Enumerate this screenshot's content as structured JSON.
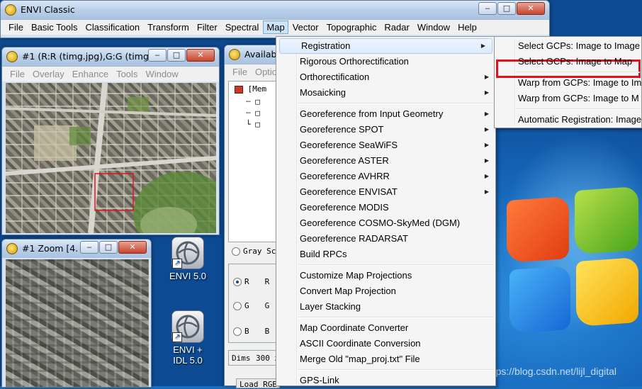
{
  "envi_main": {
    "title": "ENVI Classic",
    "menus": [
      "File",
      "Basic Tools",
      "Classification",
      "Transform",
      "Filter",
      "Spectral",
      "Map",
      "Vector",
      "Topographic",
      "Radar",
      "Window",
      "Help"
    ],
    "active_menu": "Map"
  },
  "image_window": {
    "title": "#1 (R:R (timg.jpg),G:G (timg.j...",
    "menus": [
      "File",
      "Overlay",
      "Enhance",
      "Tools",
      "Window"
    ]
  },
  "zoom_window": {
    "title": "#1 Zoom [4..."
  },
  "bands_window": {
    "title": "Availab",
    "menus": [
      "File",
      "Optio"
    ],
    "tree_root": "[Mem",
    "gray_label": "Gray Sc",
    "r_label": "R",
    "g_label": "G",
    "b_label": "B",
    "r_field": "R",
    "g_field": "G",
    "b_field": "B",
    "dims_label": "Dims",
    "dims_value": "300 x",
    "load_label": "Load RGB"
  },
  "desktop_icons": [
    {
      "label": "ENVI 5.0"
    },
    {
      "label": "ENVI + IDL 5.0"
    }
  ],
  "map_menu": [
    {
      "label": "Registration",
      "sub": true,
      "highlighted": true
    },
    {
      "label": "Rigorous Orthorectification",
      "sub": false
    },
    {
      "label": "Orthorectification",
      "sub": true
    },
    {
      "label": "Mosaicking",
      "sub": true
    },
    {
      "sep": true
    },
    {
      "label": "Georeference from Input Geometry",
      "sub": true
    },
    {
      "label": "Georeference SPOT",
      "sub": true
    },
    {
      "label": "Georeference SeaWiFS",
      "sub": true
    },
    {
      "label": "Georeference ASTER",
      "sub": true
    },
    {
      "label": "Georeference AVHRR",
      "sub": true
    },
    {
      "label": "Georeference ENVISAT",
      "sub": true
    },
    {
      "label": "Georeference MODIS",
      "sub": false
    },
    {
      "label": "Georeference COSMO-SkyMed (DGM)",
      "sub": false
    },
    {
      "label": "Georeference RADARSAT",
      "sub": false
    },
    {
      "label": "Build RPCs",
      "sub": false
    },
    {
      "sep": true
    },
    {
      "label": "Customize Map Projections",
      "sub": false
    },
    {
      "label": "Convert Map Projection",
      "sub": false
    },
    {
      "label": "Layer Stacking",
      "sub": false
    },
    {
      "sep": true
    },
    {
      "label": "Map Coordinate Converter",
      "sub": false
    },
    {
      "label": "ASCII Coordinate Conversion",
      "sub": false
    },
    {
      "label": "Merge Old \"map_proj.txt\" File",
      "sub": false
    },
    {
      "sep": true
    },
    {
      "label": "GPS-Link",
      "sub": false
    }
  ],
  "registration_submenu": [
    {
      "label": "Select GCPs: Image to Image"
    },
    {
      "label": "Select GCPs: Image to Map",
      "marked": true
    },
    {
      "sep": true
    },
    {
      "label": "Warp from GCPs: Image to Im"
    },
    {
      "label": "Warp from GCPs: Image to M"
    },
    {
      "sep": true
    },
    {
      "label": "Automatic Registration: Image"
    }
  ],
  "watermark": "https://blog.csdn.net/lijl_digital",
  "colors": {
    "annotation_box": "#e0141e",
    "menu_highlight": "#dcebfc",
    "desktop_blue": "#1565b8"
  },
  "icons": [
    "envi-app-icon",
    "shortcut-arrow-icon",
    "submenu-arrow-icon",
    "minimize-icon",
    "maximize-icon",
    "close-icon",
    "windows-logo"
  ]
}
